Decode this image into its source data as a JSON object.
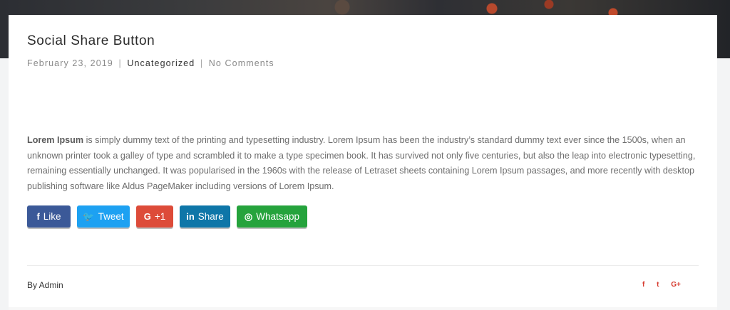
{
  "post": {
    "title": "Social Share Button",
    "date": "February 23, 2019",
    "separator": "|",
    "category": "Uncategorized",
    "comments": "No Comments",
    "content_lead": "Lorem Ipsum",
    "content_rest": " is simply dummy text of the printing and typesetting industry. Lorem Ipsum has been the industry’s standard dummy text ever since the 1500s, when an unknown printer took a galley of type and scrambled it to make a type specimen book. It has survived not only five centuries, but also the leap into electronic typesetting, remaining essentially unchanged. It was popularised in the 1960s with the release of Letraset sheets containing Lorem Ipsum passages, and more recently with desktop publishing software like Aldus PageMaker including versions of Lorem Ipsum."
  },
  "share_buttons": {
    "facebook": {
      "icon": "f",
      "label": "Like",
      "color": "#3b5998",
      "icon_name": "facebook-icon"
    },
    "twitter": {
      "icon": "🐦",
      "label": "Tweet",
      "color": "#1da1f2",
      "icon_name": "twitter-icon"
    },
    "google": {
      "icon": "G",
      "label": "+1",
      "color": "#dd4b39",
      "icon_name": "google-plus-icon"
    },
    "linkedin": {
      "icon": "in",
      "label": "Share",
      "color": "#0e76a8",
      "icon_name": "linkedin-icon"
    },
    "whatsapp": {
      "icon": "◎",
      "label": "Whatsapp",
      "color": "#25a33c",
      "icon_name": "whatsapp-icon"
    }
  },
  "footer": {
    "author": "By Admin",
    "mini_icons": {
      "facebook": "f",
      "twitter": "t",
      "google": "G+"
    },
    "accent_color": "#d63a2e"
  }
}
